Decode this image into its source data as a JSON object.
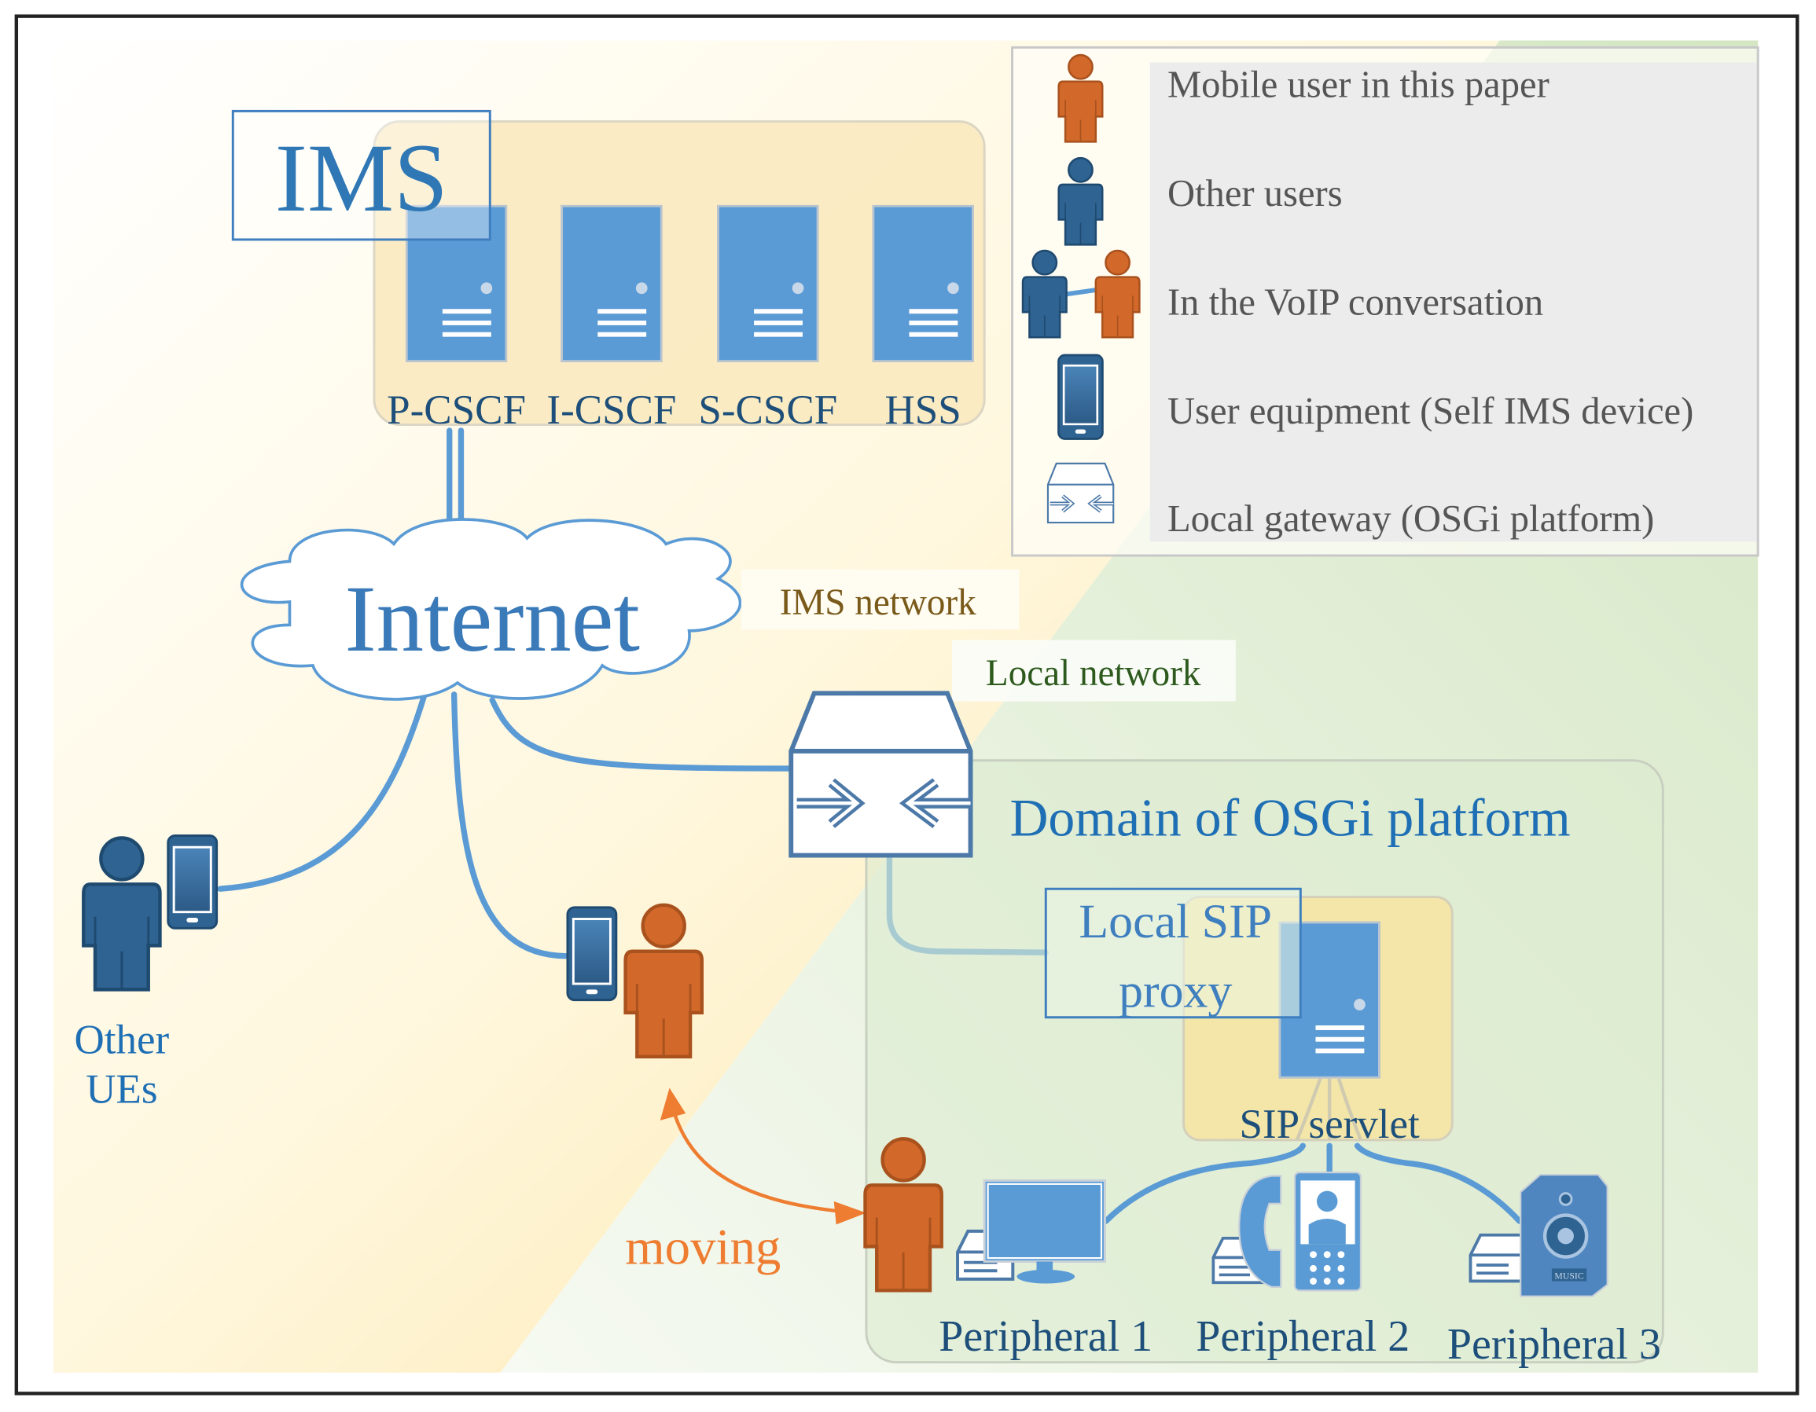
{
  "ims": {
    "title": "IMS",
    "servers": [
      "P-CSCF",
      "I-CSCF",
      "S-CSCF",
      "HSS"
    ]
  },
  "internet": {
    "label": "Internet"
  },
  "network_labels": {
    "ims_network": "IMS network",
    "local_network": "Local network"
  },
  "other_ues": {
    "line1": "Other",
    "line2": "UEs"
  },
  "moving": {
    "label": "moving"
  },
  "osgi_domain": {
    "title": "Domain of OSGi platform",
    "proxy_line1": "Local SIP",
    "proxy_line2": "proxy",
    "servlet": "SIP servlet",
    "peripherals": [
      "Peripheral 1",
      "Peripheral 2",
      "Peripheral 3"
    ],
    "speaker_badge": "MUSIC"
  },
  "legend": {
    "items": [
      {
        "icon": "orange-person-icon",
        "label": "Mobile user in this paper"
      },
      {
        "icon": "blue-person-icon",
        "label": "Other users"
      },
      {
        "icon": "voip-pair-icon",
        "label": "In the VoIP conversation"
      },
      {
        "icon": "smartphone-icon",
        "label": "User equipment (Self IMS device)"
      },
      {
        "icon": "gateway-icon",
        "label": "Local gateway (OSGi platform)"
      }
    ]
  },
  "colors": {
    "mobile_user": "#d2692a",
    "other_user": "#2f6392",
    "link": "#5b9bd5",
    "ims_zone": "#fcefc7",
    "local_zone": "#dfeccf",
    "moving_arrow": "#ee7d31"
  }
}
